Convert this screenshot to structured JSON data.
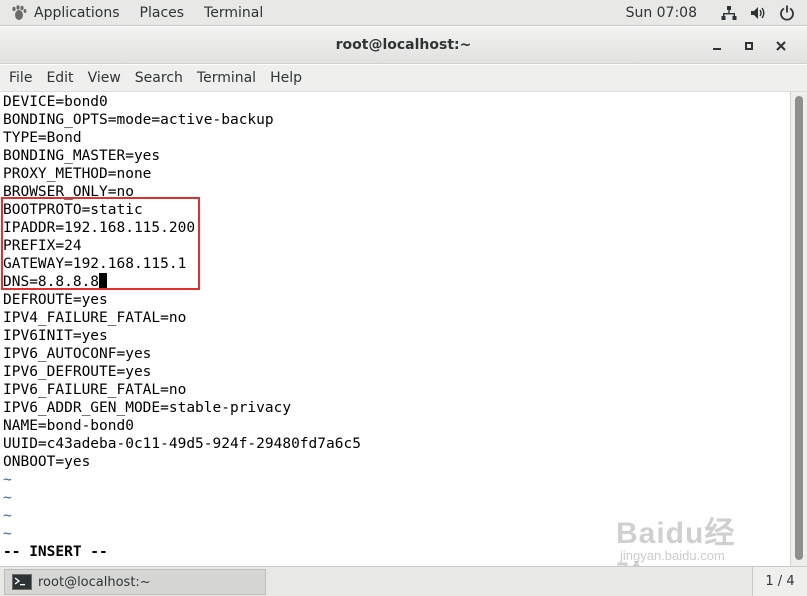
{
  "topbar": {
    "applications": "Applications",
    "places": "Places",
    "terminal": "Terminal",
    "clock": "Sun 07:08",
    "icons": [
      "applications-icon",
      "network-icon",
      "volume-icon",
      "power-icon"
    ]
  },
  "window": {
    "title": "root@localhost:~",
    "buttons": [
      "minimize",
      "maximize",
      "close"
    ]
  },
  "menubar": {
    "file": "File",
    "edit": "Edit",
    "view": "View",
    "search": "Search",
    "terminal": "Terminal",
    "help": "Help"
  },
  "terminal": {
    "lines": [
      "DEVICE=bond0",
      "BONDING_OPTS=mode=active-backup",
      "TYPE=Bond",
      "BONDING_MASTER=yes",
      "PROXY_METHOD=none",
      "BROWSER_ONLY=no",
      "BOOTPROTO=static",
      "IPADDR=192.168.115.200",
      "PREFIX=24",
      "GATEWAY=192.168.115.1",
      "DNS=8.8.8.8",
      "DEFROUTE=yes",
      "IPV4_FAILURE_FATAL=no",
      "IPV6INIT=yes",
      "IPV6_AUTOCONF=yes",
      "IPV6_DEFROUTE=yes",
      "IPV6_FAILURE_FATAL=no",
      "IPV6_ADDR_GEN_MODE=stable-privacy",
      "NAME=bond-bond0",
      "UUID=c43adeba-0c11-49d5-924f-29480fd7a6c5",
      "ONBOOT=yes"
    ],
    "empty_line_marker": "~",
    "mode": "-- INSERT --",
    "highlight_color": "#e0312f"
  },
  "taskbar": {
    "task_label": "root@localhost:~",
    "workspace": "1 / 4"
  },
  "watermark": {
    "logo": "Baidu经验",
    "url": "jingyan.baidu.com"
  }
}
